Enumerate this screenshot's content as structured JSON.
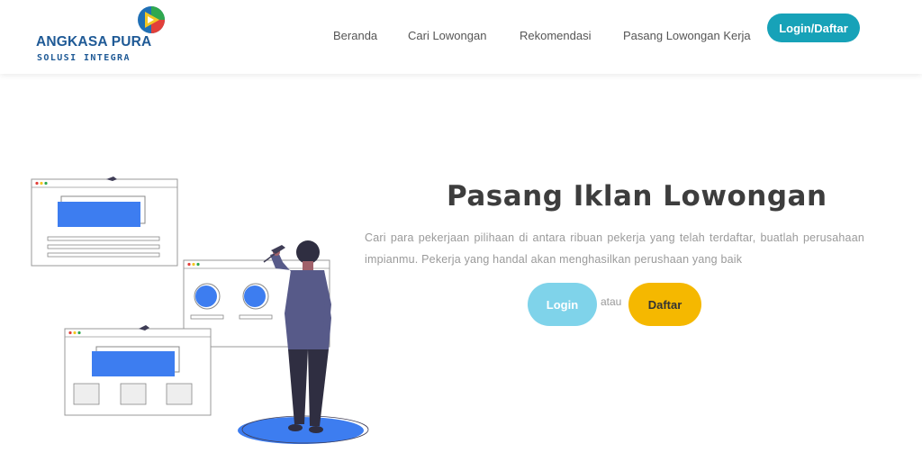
{
  "brand": {
    "name_line1": "ANGKASA PURA",
    "name_line2": "SOLUSI INTEGRA",
    "colors": {
      "primary": "#1f5a96",
      "logo_yellow": "#f3c623",
      "logo_green": "#2fa84f",
      "logo_blue": "#1f6fb5",
      "logo_red": "#e2403a"
    }
  },
  "nav": {
    "items": [
      {
        "label": "Beranda"
      },
      {
        "label": "Cari Lowongan"
      },
      {
        "label": "Rekomendasi"
      },
      {
        "label": "Pasang Lowongan Kerja"
      }
    ],
    "login_label": "Login/Daftar",
    "login_color": "#17a2b8"
  },
  "hero": {
    "title": "Pasang Iklan Lowongan",
    "description": "Cari para pekerjaan pilihaan di antara ribuan pekerja yang telah terdaftar, buatlah perusahaan impianmu. Pekerja yang handal akan menghasilkan perushaan yang baik",
    "login_label": "Login",
    "or_label": "atau",
    "register_label": "Daftar",
    "colors": {
      "login_btn": "#7fd3ea",
      "register_btn": "#f5b800",
      "illustration_blue": "#3d7df0",
      "figure_dark": "#3f3d56"
    }
  }
}
